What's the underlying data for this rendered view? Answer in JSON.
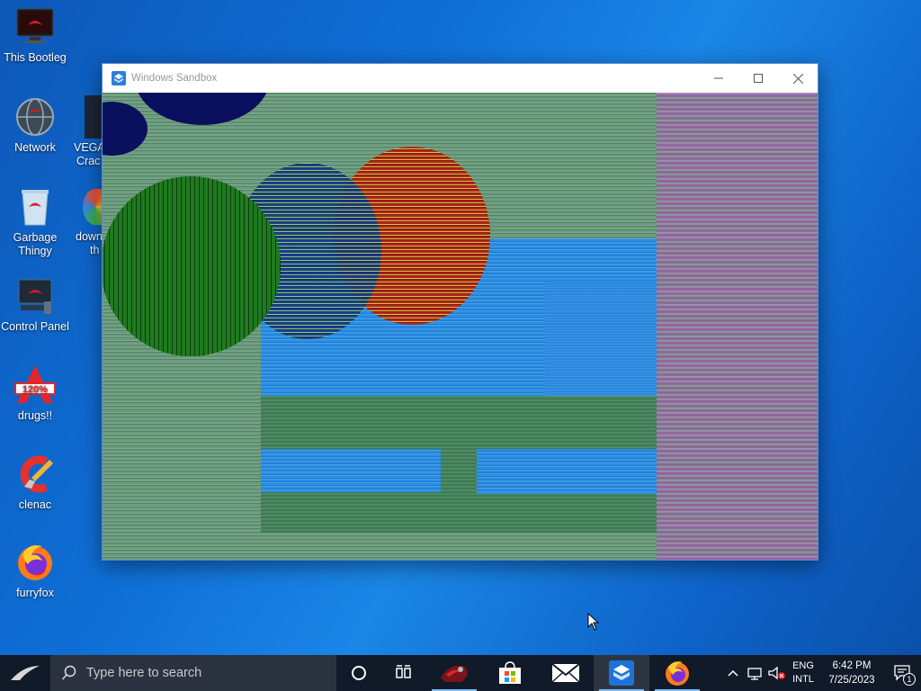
{
  "desktop": {
    "icons": [
      {
        "label": "This Bootleg",
        "icon": "computer-icon"
      },
      {
        "label": "Network",
        "icon": "network-globe-icon"
      },
      {
        "label": "Garbage Thingy",
        "icon": "recycle-bin-icon"
      },
      {
        "label": "Control Panel",
        "icon": "control-panel-icon"
      },
      {
        "label": "drugs!!",
        "icon": "acrobat-style-icon"
      },
      {
        "label": "clenac",
        "icon": "ccleaner-icon"
      },
      {
        "label": "furryfox",
        "icon": "firefox-icon"
      }
    ],
    "partial_icons": [
      {
        "label_line1": "VEGA",
        "label_line2": "Crac"
      },
      {
        "label_line1": "down",
        "label_line2": "th"
      }
    ]
  },
  "window": {
    "title": "Windows Sandbox",
    "minimize_icon": "minimize-icon",
    "maximize_icon": "maximize-icon",
    "close_icon": "close-icon"
  },
  "taskbar": {
    "search_placeholder": "Type here to search",
    "apps": [
      "cortana-icon",
      "task-view-icon",
      "rog-app-icon",
      "store-icon",
      "mail-icon",
      "sandbox-icon",
      "firefox-icon"
    ],
    "tray": {
      "lang_line1": "ENG",
      "lang_line2": "INTL",
      "time": "6:42 PM",
      "date": "7/25/2023",
      "notification_count": "1"
    }
  },
  "colors": {
    "taskbar": "#101a28",
    "accent": "#7cb9f0"
  }
}
